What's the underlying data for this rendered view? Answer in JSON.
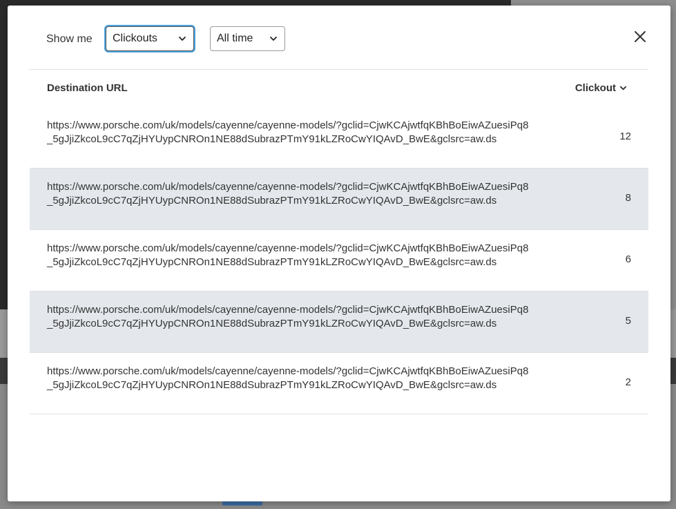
{
  "filters": {
    "show_label": "Show me",
    "metric": "Clickouts",
    "period": "All time"
  },
  "table": {
    "columns": {
      "url": "Destination URL",
      "clickout": "Clickout"
    },
    "rows": [
      {
        "url": "https://www.porsche.com/uk/models/cayenne/cayenne-models/?gclid=CjwKCAjwtfqKBhBoEiwAZuesiPq8_5gJjiZkcoL9cC7qZjHYUypCNROn1NE88dSubrazPTmY91kLZRoCwYIQAvD_BwE&gclsrc=aw.ds",
        "count": "12"
      },
      {
        "url": "https://www.porsche.com/uk/models/cayenne/cayenne-models/?gclid=CjwKCAjwtfqKBhBoEiwAZuesiPq8_5gJjiZkcoL9cC7qZjHYUypCNROn1NE88dSubrazPTmY91kLZRoCwYIQAvD_BwE&gclsrc=aw.ds",
        "count": "8"
      },
      {
        "url": "https://www.porsche.com/uk/models/cayenne/cayenne-models/?gclid=CjwKCAjwtfqKBhBoEiwAZuesiPq8_5gJjiZkcoL9cC7qZjHYUypCNROn1NE88dSubrazPTmY91kLZRoCwYIQAvD_BwE&gclsrc=aw.ds",
        "count": "6"
      },
      {
        "url": "https://www.porsche.com/uk/models/cayenne/cayenne-models/?gclid=CjwKCAjwtfqKBhBoEiwAZuesiPq8_5gJjiZkcoL9cC7qZjHYUypCNROn1NE88dSubrazPTmY91kLZRoCwYIQAvD_BwE&gclsrc=aw.ds",
        "count": "5"
      },
      {
        "url": "https://www.porsche.com/uk/models/cayenne/cayenne-models/?gclid=CjwKCAjwtfqKBhBoEiwAZuesiPq8_5gJjiZkcoL9cC7qZjHYUypCNROn1NE88dSubrazPTmY91kLZRoCwYIQAvD_BwE&gclsrc=aw.ds",
        "count": "2"
      }
    ]
  },
  "icons": {
    "select_chevron": "chevron-down-icon",
    "sort": "chevron-down-icon",
    "close": "close-icon"
  },
  "colors": {
    "focus_ring": "#4aa3df",
    "row_alt": "#e4e8ec"
  }
}
